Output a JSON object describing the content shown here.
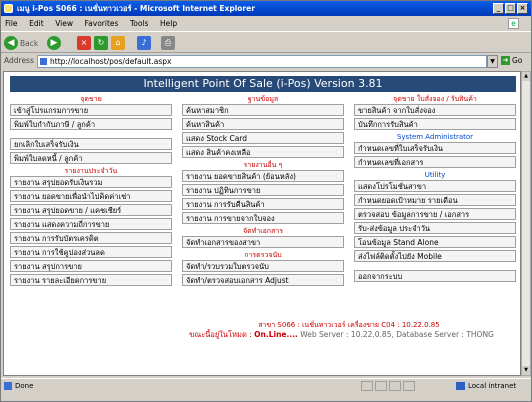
{
  "window": {
    "title": "เมนู i-Pos S066 : เนชั่นทาวเวอร์ - Microsoft Internet Explorer"
  },
  "menu": [
    "File",
    "Edit",
    "View",
    "Favorites",
    "Tools",
    "Help"
  ],
  "toolbar": {
    "back": "Back"
  },
  "address": {
    "label": "Address",
    "url": "http://localhost/pos/default.aspx",
    "go": "Go"
  },
  "pos": {
    "title": "Intelligent Point Of Sale (i-Pos) Version 3.81"
  },
  "col1": {
    "h1": "จุดขาย",
    "g1": [
      "เข้าสู่โปรแกรมการขาย",
      "พิมพ์ใบกำกับภาษี / ลูกค้า"
    ],
    "g2": [
      "ยกเลิกใบเสร็จรับเงิน",
      "พิมพ์ใบลดหนี้ / ลูกค้า"
    ],
    "h2": "รายงานประจำวัน",
    "g3": [
      "รายงาน สรุปยอดรับเงินรวม",
      "รายงาน ยอดขายเพื่อนำไปคิดค่าเช่า",
      "รายงาน สรุปยอดขาย / แคชเชียร์",
      "รายงาน แสดงความถี่การขาย",
      "รายงาน การรับบัตรเครดิต",
      "รายงาน การใช้คูปองส่วนลด",
      "รายงาน สรุปการขาย",
      "รายงาน รายละเอียดการขาย"
    ]
  },
  "col2": {
    "h1": "ฐานข้อมูล",
    "g1": [
      "ค้นหาสมาชิก",
      "ค้นหาสินค้า",
      "แสดง Stock Card",
      "แสดง สินค้าคงเหลือ"
    ],
    "h2": "รายงานอื่น ๆ",
    "g2": [
      "รายงาน ยอดขายสินค้า (ย้อนหลัง)",
      "รายงาน ปฏิทินการขาย",
      "รายงาน การรับคืนสินค้า",
      "รายงาน การขายจากใบจอง"
    ],
    "h3": "จัดทำเอกสาร",
    "g3": [
      "จัดทำเอกสารของสาขา"
    ],
    "h4": "การตรวจนับ",
    "g4": [
      "จัดทำ/รวบรวมใบตรวจนับ",
      "จัดทำ/ตรวจสอบเอกสาร Adjust"
    ]
  },
  "col3": {
    "h1": "จุดขาย ใบสั่งจอง / รับสินค้า",
    "g1": [
      "ขายสินค้า จากใบสั่งจอง",
      "บันทึกการรับสินค้า"
    ],
    "h2": "System Administrator",
    "g2": [
      "กำหนดเลขที่ใบเสร็จรับเงิน",
      "กำหนดเลขที่เอกสาร"
    ],
    "h3": "Utility",
    "g3": [
      "แสดงโปรโมชั่นสาขา",
      "กำหนดยอดเป้าหมาย รายเดือน",
      "ตรวจสอบ ข้อมูลการขาย / เอกสาร",
      "รับ-ส่งข้อมูล ประจำวัน",
      "โอนข้อมูล Stand Alone",
      "ส่งไฟล์ติดตั้งไปยัง Mobile"
    ],
    "g4": [
      "ออกจากระบบ"
    ]
  },
  "footer": {
    "line1": "สาขา S066 : เนชั่นทาวเวอร์ เครื่องขาย C04 : 10.22.0.85",
    "mode_label": "ขณะนี้อยู่ในโหมด :",
    "mode": "On.Line....",
    "server": "Web Server : 10.22.0.85,",
    "db": "Database Server : THONG"
  },
  "status": {
    "done": "Done",
    "zone": "Local intranet"
  }
}
